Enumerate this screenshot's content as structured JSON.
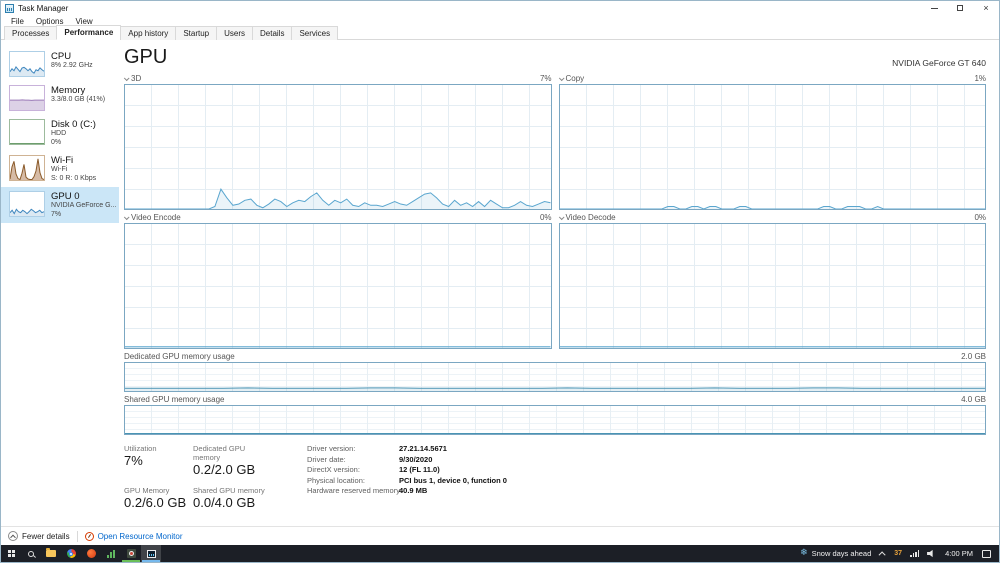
{
  "window": {
    "title": "Task Manager"
  },
  "menu": {
    "items": [
      {
        "label": "File"
      },
      {
        "label": "Options"
      },
      {
        "label": "View"
      }
    ]
  },
  "tabs": {
    "active": "Performance",
    "items": [
      {
        "label": "Processes"
      },
      {
        "label": "Performance"
      },
      {
        "label": "App history"
      },
      {
        "label": "Startup"
      },
      {
        "label": "Users"
      },
      {
        "label": "Details"
      },
      {
        "label": "Services"
      }
    ]
  },
  "sidebar": {
    "items": [
      {
        "title": "CPU",
        "line1": "8% 2.92 GHz",
        "line2": ""
      },
      {
        "title": "Memory",
        "line1": "3.3/8.0 GB (41%)",
        "line2": ""
      },
      {
        "title": "Disk 0 (C:)",
        "line1": "HDD",
        "line2": "0%"
      },
      {
        "title": "Wi-Fi",
        "line1": "Wi-Fi",
        "line2": "S: 0 R: 0 Kbps"
      },
      {
        "title": "GPU 0",
        "line1": "NVIDIA GeForce G...",
        "line2": "7%"
      }
    ]
  },
  "main": {
    "title": "GPU",
    "device": "NVIDIA GeForce GT 640",
    "panels": {
      "gpu3d": {
        "label": "3D",
        "value": "7%"
      },
      "copy": {
        "label": "Copy",
        "value": "1%"
      },
      "encode": {
        "label": "Video Encode",
        "value": "0%"
      },
      "decode": {
        "label": "Video Decode",
        "value": "0%"
      },
      "dedicated": {
        "label": "Dedicated GPU memory usage",
        "value": "2.0 GB"
      },
      "shared": {
        "label": "Shared GPU memory usage",
        "value": "4.0 GB"
      }
    },
    "stats": {
      "utilization": {
        "label": "Utilization",
        "value": "7%"
      },
      "dedicated_memory": {
        "label": "Dedicated GPU memory",
        "value": "0.2/2.0 GB"
      },
      "gpu_memory": {
        "label": "GPU Memory",
        "value": "0.2/6.0 GB"
      },
      "shared_memory": {
        "label": "Shared GPU memory",
        "value": "0.0/4.0 GB"
      }
    },
    "details": [
      {
        "label": "Driver version:",
        "value": "27.21.14.5671"
      },
      {
        "label": "Driver date:",
        "value": "9/30/2020"
      },
      {
        "label": "DirectX version:",
        "value": "12 (FL 11.0)"
      },
      {
        "label": "Physical location:",
        "value": "PCI bus 1, device 0, function 0"
      },
      {
        "label": "Hardware reserved memory:",
        "value": "40.9 MB"
      }
    ]
  },
  "footer": {
    "fewer_details": "Fewer details",
    "resource_monitor": "Open Resource Monitor"
  },
  "taskbar": {
    "weather_text": "Snow days ahead",
    "temp": "37",
    "time": "4:00 PM"
  },
  "icons": {
    "snowflake": "❄",
    "close": "×"
  },
  "colors": {
    "chart_line_blue": "#5aa6cf",
    "chart_border": "#7ba7c2",
    "selected_sidebar": "#cbe6f7",
    "link": "#0066cc",
    "taskbar_bg": "#1c1f26",
    "weather_accent": "#7ec3e8"
  },
  "chart_data": {
    "gpu3d": {
      "type": "area",
      "ylim": [
        0,
        100
      ],
      "title": "3D",
      "values": [
        0,
        0,
        0,
        0,
        0,
        0,
        0,
        0,
        0,
        0,
        0,
        0,
        0,
        0,
        0,
        2,
        16,
        9,
        3,
        4,
        7,
        8,
        3,
        1,
        4,
        8,
        6,
        2,
        5,
        7,
        6,
        10,
        13,
        7,
        3,
        7,
        5,
        8,
        3,
        2,
        5,
        3,
        3,
        2,
        4,
        6,
        4,
        3,
        6,
        9,
        12,
        13,
        9,
        4,
        2,
        7,
        3,
        5,
        2,
        6,
        2,
        7,
        4,
        1,
        1,
        3,
        6,
        3,
        2,
        4,
        6,
        5
      ]
    },
    "copy": {
      "type": "area",
      "ylim": [
        0,
        100
      ],
      "title": "Copy",
      "values": [
        0,
        0,
        0,
        0,
        0,
        0,
        0,
        0,
        0,
        0,
        0,
        0,
        0,
        0,
        0,
        0,
        0,
        0,
        2,
        2,
        0,
        0,
        2,
        2,
        0,
        2,
        2,
        0,
        0,
        0,
        2,
        2,
        0,
        0,
        0,
        0,
        0,
        0,
        0,
        0,
        0,
        0,
        0,
        0,
        2,
        2,
        0,
        0,
        2,
        2,
        2,
        0,
        0,
        2,
        0,
        0,
        0,
        0,
        0,
        0,
        0,
        0,
        0,
        0,
        0,
        0,
        0,
        0,
        0,
        0,
        0,
        0
      ]
    },
    "encode": {
      "type": "area",
      "ylim": [
        0,
        100
      ],
      "title": "Video Encode",
      "values": [
        1,
        1
      ]
    },
    "decode": {
      "type": "area",
      "ylim": [
        0,
        100
      ],
      "title": "Video Decode",
      "values": [
        1,
        1
      ]
    },
    "dedicated": {
      "type": "area",
      "ylim": [
        0,
        100
      ],
      "title": "Dedicated GPU memory usage",
      "values": [
        10,
        10,
        10,
        10,
        10,
        11,
        10,
        10,
        10,
        10,
        11,
        11,
        10,
        10,
        10,
        10,
        10,
        10,
        11,
        10,
        10,
        10,
        10,
        10,
        11,
        10,
        10,
        10,
        11,
        11,
        10,
        10,
        10,
        10,
        10,
        10
      ]
    },
    "shared": {
      "type": "area",
      "ylim": [
        0,
        100
      ],
      "title": "Shared GPU memory usage",
      "values": [
        2,
        2
      ]
    },
    "spark_cpu": {
      "type": "area",
      "values": [
        18,
        30,
        22,
        38,
        28,
        18,
        33,
        36,
        30,
        22,
        30,
        18,
        12,
        26,
        22,
        34,
        26,
        20
      ]
    },
    "spark_memory": {
      "type": "area",
      "values": [
        41,
        41,
        41,
        41,
        42,
        41,
        41,
        40,
        41,
        41,
        41,
        41
      ]
    },
    "spark_disk": {
      "type": "area",
      "values": [
        2,
        2
      ]
    },
    "spark_wifi": {
      "type": "area",
      "values": [
        4,
        55,
        78,
        25,
        6,
        2,
        28,
        65,
        12,
        4,
        2,
        2,
        14,
        38,
        88,
        30,
        6,
        2
      ]
    },
    "spark_gpu": {
      "type": "area",
      "values": [
        14,
        24,
        10,
        28,
        18,
        14,
        24,
        18,
        10,
        18,
        28,
        22,
        14,
        18,
        24,
        14,
        18
      ]
    }
  }
}
